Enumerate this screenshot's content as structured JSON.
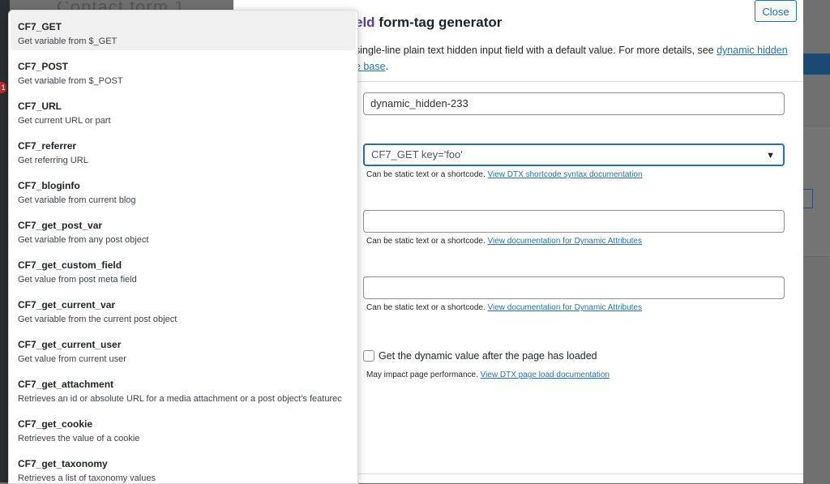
{
  "modal": {
    "title_accent": "eld",
    "title_rest": " form-tag generator",
    "description_line1": "single-line plain text hidden input field with a default value. For more details, see ",
    "description_link1": "dynamic hidden",
    "description_link2": "e base",
    "description_end": ".",
    "close_label": "Close",
    "name_value": "dynamic_hidden-233",
    "default_value": "CF7_GET key='foo'",
    "default_hint_prefix": "Can be static text or a shortcode. ",
    "default_hint_link": "View DTX shortcode syntax documentation",
    "field2_hint_prefix": "Can be static text or a shortcode. ",
    "field2_hint_link": "View documentation for Dynamic Attributes",
    "field3_hint_prefix": "Can be static text or a shortcode. ",
    "field3_hint_link": "View documentation for Dynamic Attributes",
    "checkbox_label": "Get the dynamic value after the page has loaded",
    "perf_hint_prefix": "May impact page performance. ",
    "perf_hint_link": "View DTX page load documentation"
  },
  "dropdown": {
    "options": [
      {
        "name": "CF7_GET",
        "desc": "Get variable from $_GET"
      },
      {
        "name": "CF7_POST",
        "desc": "Get variable from $_POST"
      },
      {
        "name": "CF7_URL",
        "desc": "Get current URL or part"
      },
      {
        "name": "CF7_referrer",
        "desc": "Get referring URL"
      },
      {
        "name": "CF7_bloginfo",
        "desc": "Get variable from current blog"
      },
      {
        "name": "CF7_get_post_var",
        "desc": "Get variable from any post object"
      },
      {
        "name": "CF7_get_custom_field",
        "desc": "Get value from post meta field"
      },
      {
        "name": "CF7_get_current_var",
        "desc": "Get variable from the current post object"
      },
      {
        "name": "CF7_get_current_user",
        "desc": "Get value from current user"
      },
      {
        "name": "CF7_get_attachment",
        "desc": "Retrieves an id or absolute URL for a media attachment or a post object's featurec"
      },
      {
        "name": "CF7_get_cookie",
        "desc": "Retrieves the value of a cookie"
      },
      {
        "name": "CF7_get_taxonomy",
        "desc": "Retrieves a list of taxonomy values"
      }
    ]
  },
  "background": {
    "badge": "1",
    "title": "Contact form 1"
  },
  "colors": {
    "accent": "#5b3ba8",
    "link": "#2271b1",
    "selected_bg": "#f0f0f1"
  }
}
